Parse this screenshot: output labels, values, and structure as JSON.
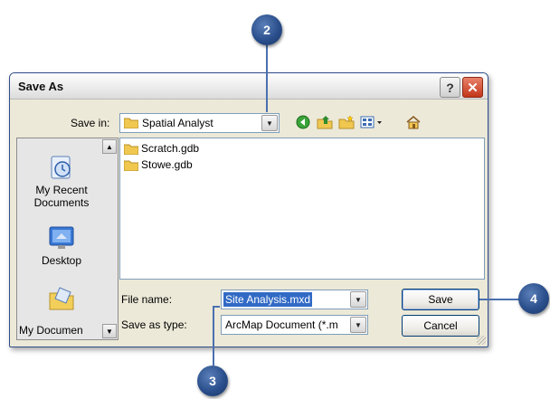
{
  "dialog": {
    "title": "Save As",
    "help_label": "?",
    "close_label": "✕"
  },
  "toolbar": {
    "save_in_label": "Save in:",
    "save_in_value": "Spatial Analyst",
    "icons": [
      "back-icon",
      "up-folder-icon",
      "new-folder-icon",
      "views-menu-icon",
      "home-icon"
    ]
  },
  "places": [
    {
      "label": "My Recent Documents",
      "icon": "recent-documents-icon"
    },
    {
      "label": "Desktop",
      "icon": "desktop-icon"
    },
    {
      "label": "My Documen",
      "icon": "my-documents-icon"
    }
  ],
  "files": [
    {
      "name": "Scratch.gdb",
      "icon": "folder-icon"
    },
    {
      "name": "Stowe.gdb",
      "icon": "folder-icon"
    }
  ],
  "form": {
    "file_name_label": "File name:",
    "file_name_value": "Site Analysis.mxd",
    "save_type_label": "Save as type:",
    "save_type_value": "ArcMap Document (*.m"
  },
  "buttons": {
    "save": "Save",
    "cancel": "Cancel"
  },
  "callouts": [
    "2",
    "3",
    "4"
  ],
  "colors": {
    "callout": "#2a4f8c",
    "window_border": "#2f4e8a",
    "dialog_bg": "#ece9d8",
    "selection": "#316ac5"
  }
}
